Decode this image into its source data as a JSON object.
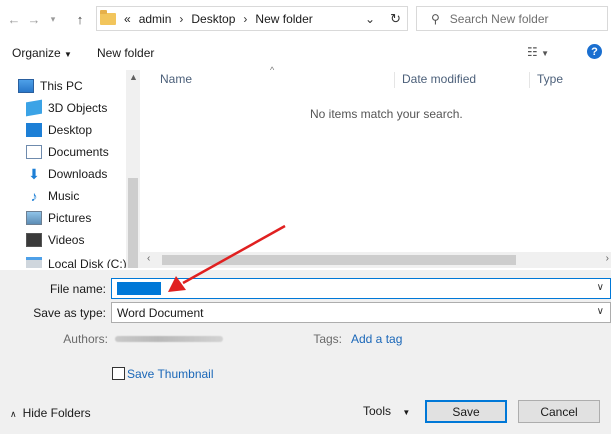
{
  "address": {
    "breadcrumbs": [
      "admin",
      "Desktop",
      "New folder"
    ],
    "overflow": "«",
    "separator": "›",
    "search_placeholder": "Search New folder"
  },
  "toolbar": {
    "organize_label": "Organize",
    "new_folder_label": "New folder"
  },
  "nav_pane": {
    "items": [
      {
        "label": "This PC",
        "icon": "computer-icon"
      },
      {
        "label": "3D Objects",
        "icon": "cube-icon"
      },
      {
        "label": "Desktop",
        "icon": "desktop-icon"
      },
      {
        "label": "Documents",
        "icon": "document-icon"
      },
      {
        "label": "Downloads",
        "icon": "download-arrow-icon"
      },
      {
        "label": "Music",
        "icon": "music-note-icon"
      },
      {
        "label": "Pictures",
        "icon": "picture-icon"
      },
      {
        "label": "Videos",
        "icon": "film-icon"
      },
      {
        "label": "Local Disk (C:)",
        "icon": "drive-icon"
      }
    ]
  },
  "content": {
    "columns": [
      "Name",
      "Date modified",
      "Type"
    ],
    "empty_message": "No items match your search."
  },
  "form": {
    "file_name_label": "File name:",
    "file_name_value": "",
    "save_as_type_label": "Save as type:",
    "save_as_type_value": "Word Document",
    "authors_label": "Authors:",
    "tags_label": "Tags:",
    "add_tag_label": "Add a tag",
    "save_thumbnail_label": "Save Thumbnail",
    "save_thumbnail_checked": false
  },
  "footer": {
    "hide_folders_label": "Hide Folders",
    "tools_label": "Tools",
    "save_label": "Save",
    "cancel_label": "Cancel"
  },
  "colors": {
    "accent": "#0078d7",
    "link": "#1a67b8",
    "annotation_arrow": "#e02020",
    "panel_bg": "#f0f0f0"
  }
}
